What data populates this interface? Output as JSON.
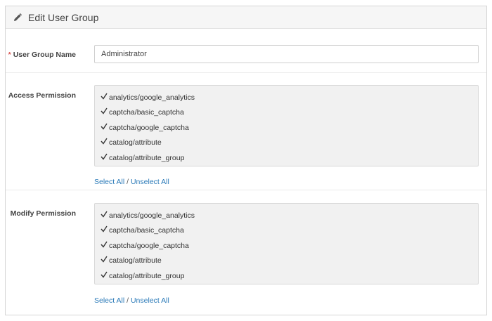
{
  "header": {
    "title": "Edit User Group",
    "icon": "pencil-icon"
  },
  "user_group_name": {
    "label": "User Group Name",
    "required_mark": "*",
    "value": "Administrator"
  },
  "access_permission": {
    "label": "Access Permission",
    "items": [
      {
        "label": "analytics/google_analytics",
        "checked": true
      },
      {
        "label": "captcha/basic_captcha",
        "checked": true
      },
      {
        "label": "captcha/google_captcha",
        "checked": true
      },
      {
        "label": "catalog/attribute",
        "checked": true
      },
      {
        "label": "catalog/attribute_group",
        "checked": true
      }
    ],
    "select_all": "Select All",
    "separator": "/",
    "unselect_all": "Unselect All"
  },
  "modify_permission": {
    "label": "Modify Permission",
    "items": [
      {
        "label": "analytics/google_analytics",
        "checked": true
      },
      {
        "label": "captcha/basic_captcha",
        "checked": true
      },
      {
        "label": "captcha/google_captcha",
        "checked": true
      },
      {
        "label": "catalog/attribute",
        "checked": true
      },
      {
        "label": "catalog/attribute_group",
        "checked": true
      }
    ],
    "select_all": "Select All",
    "separator": "/",
    "unselect_all": "Unselect All"
  },
  "colors": {
    "link": "#2a7ab8",
    "required": "#d9534f",
    "well_bg": "#f1f1f1"
  }
}
